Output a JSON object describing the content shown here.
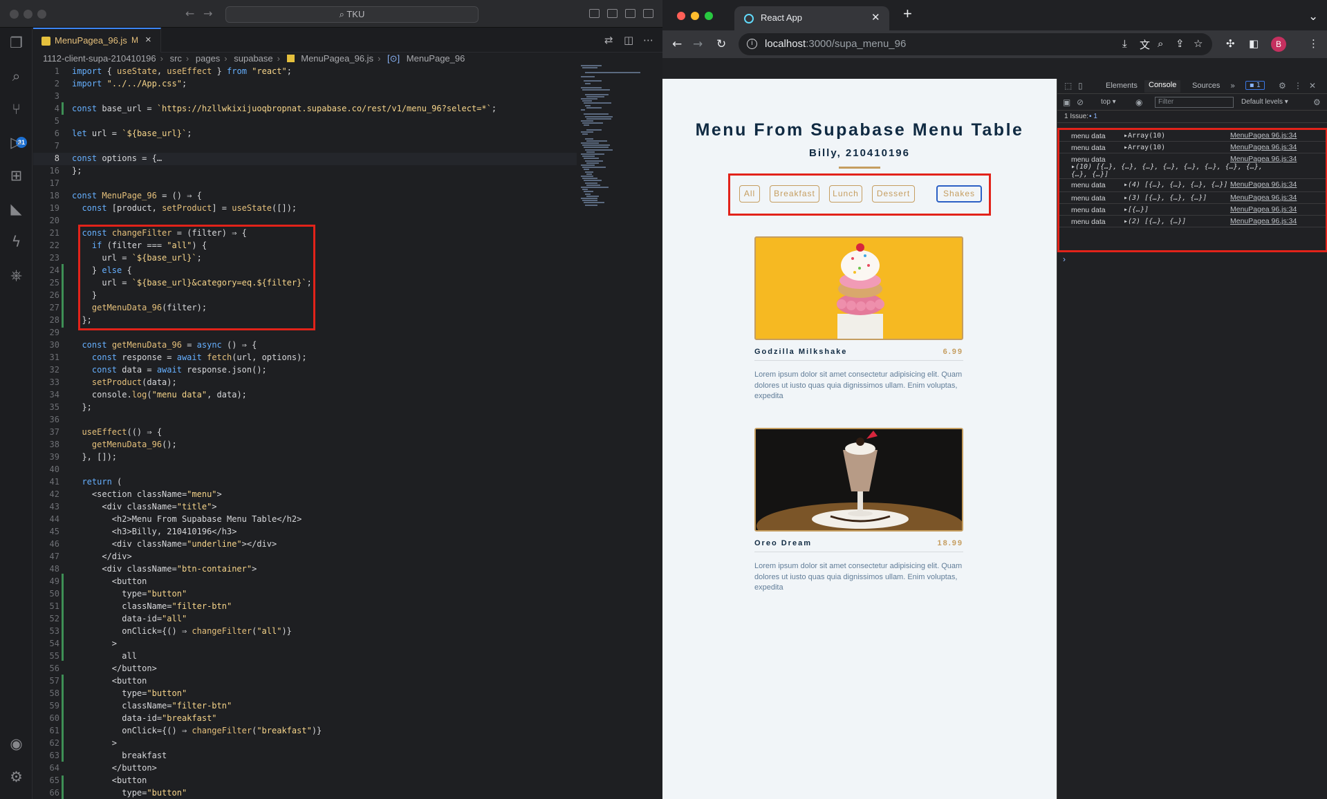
{
  "vscode": {
    "search": "TKU",
    "tab": {
      "name": "MenuPagea_96.js",
      "status": "M"
    },
    "breadcrumb": [
      "1112-client-supa-210410196",
      "src",
      "pages",
      "supabase",
      "MenuPagea_96.js",
      "MenuPage_96"
    ],
    "source_control_badge": "31",
    "code": [
      {
        "n": "1",
        "t": "import { useState, useEffect } from \"react\";"
      },
      {
        "n": "2",
        "t": "import \"../../App.css\";"
      },
      {
        "n": "3",
        "t": ""
      },
      {
        "n": "4",
        "t": "const base_url = `https://hzllwkixijuoqbropnat.supabase.co/rest/v1/menu_96?select=*`;"
      },
      {
        "n": "5",
        "t": ""
      },
      {
        "n": "6",
        "t": "let url = `${base_url}`;"
      },
      {
        "n": "7",
        "t": ""
      },
      {
        "n": "8",
        "t": "const options = {…"
      },
      {
        "n": "16",
        "t": "};"
      },
      {
        "n": "17",
        "t": ""
      },
      {
        "n": "18",
        "t": "const MenuPage_96 = () ⇒ {"
      },
      {
        "n": "19",
        "t": "  const [product, setProduct] = useState([]);"
      },
      {
        "n": "20",
        "t": ""
      },
      {
        "n": "21",
        "t": "  const changeFilter = (filter) ⇒ {"
      },
      {
        "n": "22",
        "t": "    if (filter === \"all\") {"
      },
      {
        "n": "23",
        "t": "      url = `${base_url}`;"
      },
      {
        "n": "24",
        "t": "    } else {"
      },
      {
        "n": "25",
        "t": "      url = `${base_url}&category=eq.${filter}`;"
      },
      {
        "n": "26",
        "t": "    }"
      },
      {
        "n": "27",
        "t": "    getMenuData_96(filter);"
      },
      {
        "n": "28",
        "t": "  };"
      },
      {
        "n": "29",
        "t": ""
      },
      {
        "n": "30",
        "t": "  const getMenuData_96 = async () ⇒ {"
      },
      {
        "n": "31",
        "t": "    const response = await fetch(url, options);"
      },
      {
        "n": "32",
        "t": "    const data = await response.json();"
      },
      {
        "n": "33",
        "t": "    setProduct(data);"
      },
      {
        "n": "34",
        "t": "    console.log(\"menu data\", data);"
      },
      {
        "n": "35",
        "t": "  };"
      },
      {
        "n": "36",
        "t": ""
      },
      {
        "n": "37",
        "t": "  useEffect(() ⇒ {"
      },
      {
        "n": "38",
        "t": "    getMenuData_96();"
      },
      {
        "n": "39",
        "t": "  }, []);"
      },
      {
        "n": "40",
        "t": ""
      },
      {
        "n": "41",
        "t": "  return ("
      },
      {
        "n": "42",
        "t": "    <section className=\"menu\">"
      },
      {
        "n": "43",
        "t": "      <div className=\"title\">"
      },
      {
        "n": "44",
        "t": "        <h2>Menu From Supabase Menu Table</h2>"
      },
      {
        "n": "45",
        "t": "        <h3>Billy, 210410196</h3>"
      },
      {
        "n": "46",
        "t": "        <div className=\"underline\"></div>"
      },
      {
        "n": "47",
        "t": "      </div>"
      },
      {
        "n": "48",
        "t": "      <div className=\"btn-container\">"
      },
      {
        "n": "49",
        "t": "        <button"
      },
      {
        "n": "50",
        "t": "          type=\"button\""
      },
      {
        "n": "51",
        "t": "          className=\"filter-btn\""
      },
      {
        "n": "52",
        "t": "          data-id=\"all\""
      },
      {
        "n": "53",
        "t": "          onClick={() ⇒ changeFilter(\"all\")}"
      },
      {
        "n": "54",
        "t": "        >"
      },
      {
        "n": "55",
        "t": "          all"
      },
      {
        "n": "56",
        "t": "        </button>"
      },
      {
        "n": "57",
        "t": "        <button"
      },
      {
        "n": "58",
        "t": "          type=\"button\""
      },
      {
        "n": "59",
        "t": "          className=\"filter-btn\""
      },
      {
        "n": "60",
        "t": "          data-id=\"breakfast\""
      },
      {
        "n": "61",
        "t": "          onClick={() ⇒ changeFilter(\"breakfast\")}"
      },
      {
        "n": "62",
        "t": "        >"
      },
      {
        "n": "63",
        "t": "          breakfast"
      },
      {
        "n": "64",
        "t": "        </button>"
      },
      {
        "n": "65",
        "t": "        <button"
      },
      {
        "n": "66",
        "t": "          type=\"button\""
      }
    ]
  },
  "chrome": {
    "tab_title": "React App",
    "url_host": "localhost",
    "url_rest": ":3000/supa_menu_96",
    "avatar": "B"
  },
  "page": {
    "title": "Menu From Supabase Menu Table",
    "subtitle": "Billy, 210410196",
    "buttons": [
      "All",
      "Breakfast",
      "Lunch",
      "Dessert",
      "Shakes"
    ],
    "selected_button": "Shakes",
    "items": [
      {
        "name": "Godzilla Milkshake",
        "price": "6.99",
        "desc": "Lorem ipsum dolor sit amet consectetur adipisicing elit. Quam dolores ut iusto quas quia dignissimos ullam. Enim voluptas, expedita"
      },
      {
        "name": "Oreo Dream",
        "price": "18.99",
        "desc": "Lorem ipsum dolor sit amet consectetur adipisicing elit. Quam dolores ut iusto quas quia dignissimos ullam. Enim voluptas, expedita"
      }
    ]
  },
  "devtools": {
    "tabs": [
      "Elements",
      "Console",
      "Sources"
    ],
    "active_tab": "Console",
    "msg_count": "1",
    "context": "top",
    "filter_placeholder": "Filter",
    "levels": "Default levels",
    "issues": "1 Issue:",
    "issue_count": "1",
    "logs": [
      {
        "k": "menu data",
        "v": "▸Array(10)",
        "src": "MenuPagea 96.js:34"
      },
      {
        "k": "menu data",
        "v": "▸Array(10)",
        "src": "MenuPagea 96.js:34"
      },
      {
        "k": "menu data",
        "v": "▸(10) [{…}, {…}, {…}, {…}, {…}, {…}, {…}, {…}, {…}, {…}]",
        "src": "MenuPagea 96.js:34"
      },
      {
        "k": "menu data",
        "v": "▸(4) [{…}, {…}, {…}, {…}]",
        "src": "MenuPagea 96.js:34"
      },
      {
        "k": "menu data",
        "v": "▸(3) [{…}, {…}, {…}]",
        "src": "MenuPagea 96.js:34"
      },
      {
        "k": "menu data",
        "v": "▸[{…}]",
        "src": "MenuPagea 96.js:34"
      },
      {
        "k": "menu data",
        "v": "▸(2) [{…}, {…}]",
        "src": "MenuPagea 96.js:34"
      }
    ]
  }
}
